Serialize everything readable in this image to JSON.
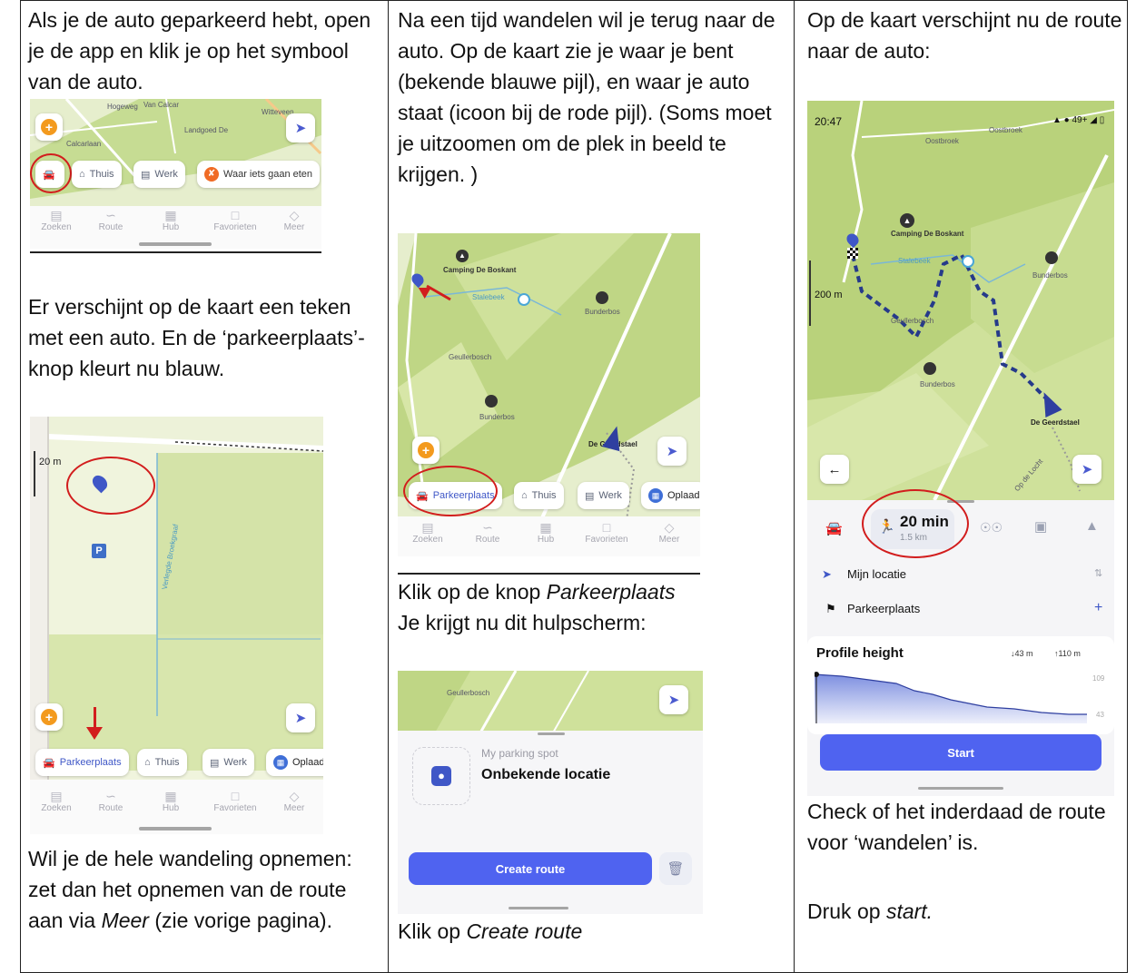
{
  "col1": {
    "intro": "Als je de auto geparkeerd hebt, open je de app en klik je op het symbool van de auto.",
    "shot1": {
      "chips": [
        "Thuis",
        "Werk",
        "Waar iets gaan eten"
      ],
      "nav": [
        "Zoeken",
        "Route",
        "Hub",
        "Favorieten",
        "Meer"
      ],
      "map_labels": [
        "Hogeweg",
        "Van Calcar",
        "Calcarlaan",
        "Landgoed De",
        "Witteveen"
      ]
    },
    "para2": "Er verschijnt op de kaart een teken met een auto. En de ‘parkeerplaats’-knop kleurt nu blauw.",
    "shot2": {
      "scale": "20 m",
      "parking_badge": "P",
      "chips": [
        "Parkeerplaats",
        "Thuis",
        "Werk",
        "Oplaad"
      ],
      "nav": [
        "Zoeken",
        "Route",
        "Hub",
        "Favorieten",
        "Meer"
      ],
      "map_labels": [
        "Verlegde Broekgraaf"
      ]
    },
    "para3_a": "Wil je de hele wandeling opnemen: zet dan het opnemen van de route aan via ",
    "para3_meer": "Meer",
    "para3_b": " (zie vorige pagina)."
  },
  "col2": {
    "intro": "Na een tijd wandelen wil je terug naar de auto. Op de kaart zie je waar je bent (bekende blauwe pijl), en waar je auto staat (icoon bij de rode pijl). (Soms moet je uitzoomen om de plek in beeld te krijgen. )",
    "shot3": {
      "map_labels": [
        "Camping De Boskant",
        "Stalebeek",
        "Bunderbos",
        "Geullerbosch",
        "Bunderbos",
        "De Geerdstael"
      ],
      "chips": [
        "Parkeerplaats",
        "Thuis",
        "Werk",
        "Oplaad"
      ],
      "nav": [
        "Zoeken",
        "Route",
        "Hub",
        "Favorieten",
        "Meer"
      ]
    },
    "line1_a": "Klik op de knop ",
    "line1_b": "Parkeerplaats",
    "line2": "Je krijgt nu dit hulpscherm:",
    "shot4": {
      "map_label": "Geullerbosch",
      "sub": "My parking spot",
      "title": "Onbekende locatie",
      "button": "Create route"
    },
    "line3_a": "Klik op ",
    "line3_b": "Create route"
  },
  "col3": {
    "intro": "Op de kaart verschijnt nu de route naar de auto:",
    "shot5": {
      "time": "20:47",
      "map_labels": [
        "Oostbroek",
        "Oostbroek",
        "Camping De Boskant",
        "Stalebeek",
        "Bunderbos",
        "Geullerbosch",
        "Bunderbos",
        "De Geerdstael",
        "Op de Locht"
      ],
      "scale": "200 m",
      "duration": "20 min",
      "distance": "1.5 km",
      "from": "Mijn locatie",
      "to": "Parkeerplaats",
      "profile_title": "Profile height",
      "down": "↓43 m",
      "up": "↑110 m",
      "ymax": "109",
      "ymin": "43",
      "start": "Start"
    },
    "para2": "Check of het inderdaad de route voor ‘wandelen’ is.",
    "para3_a": "Druk op ",
    "para3_b": "start."
  },
  "colors": {
    "accent": "#4f63f0",
    "route": "#263a8a",
    "annotation_red": "#d21d1d",
    "forest": "#c3d98c",
    "grass": "#e4edc8"
  }
}
